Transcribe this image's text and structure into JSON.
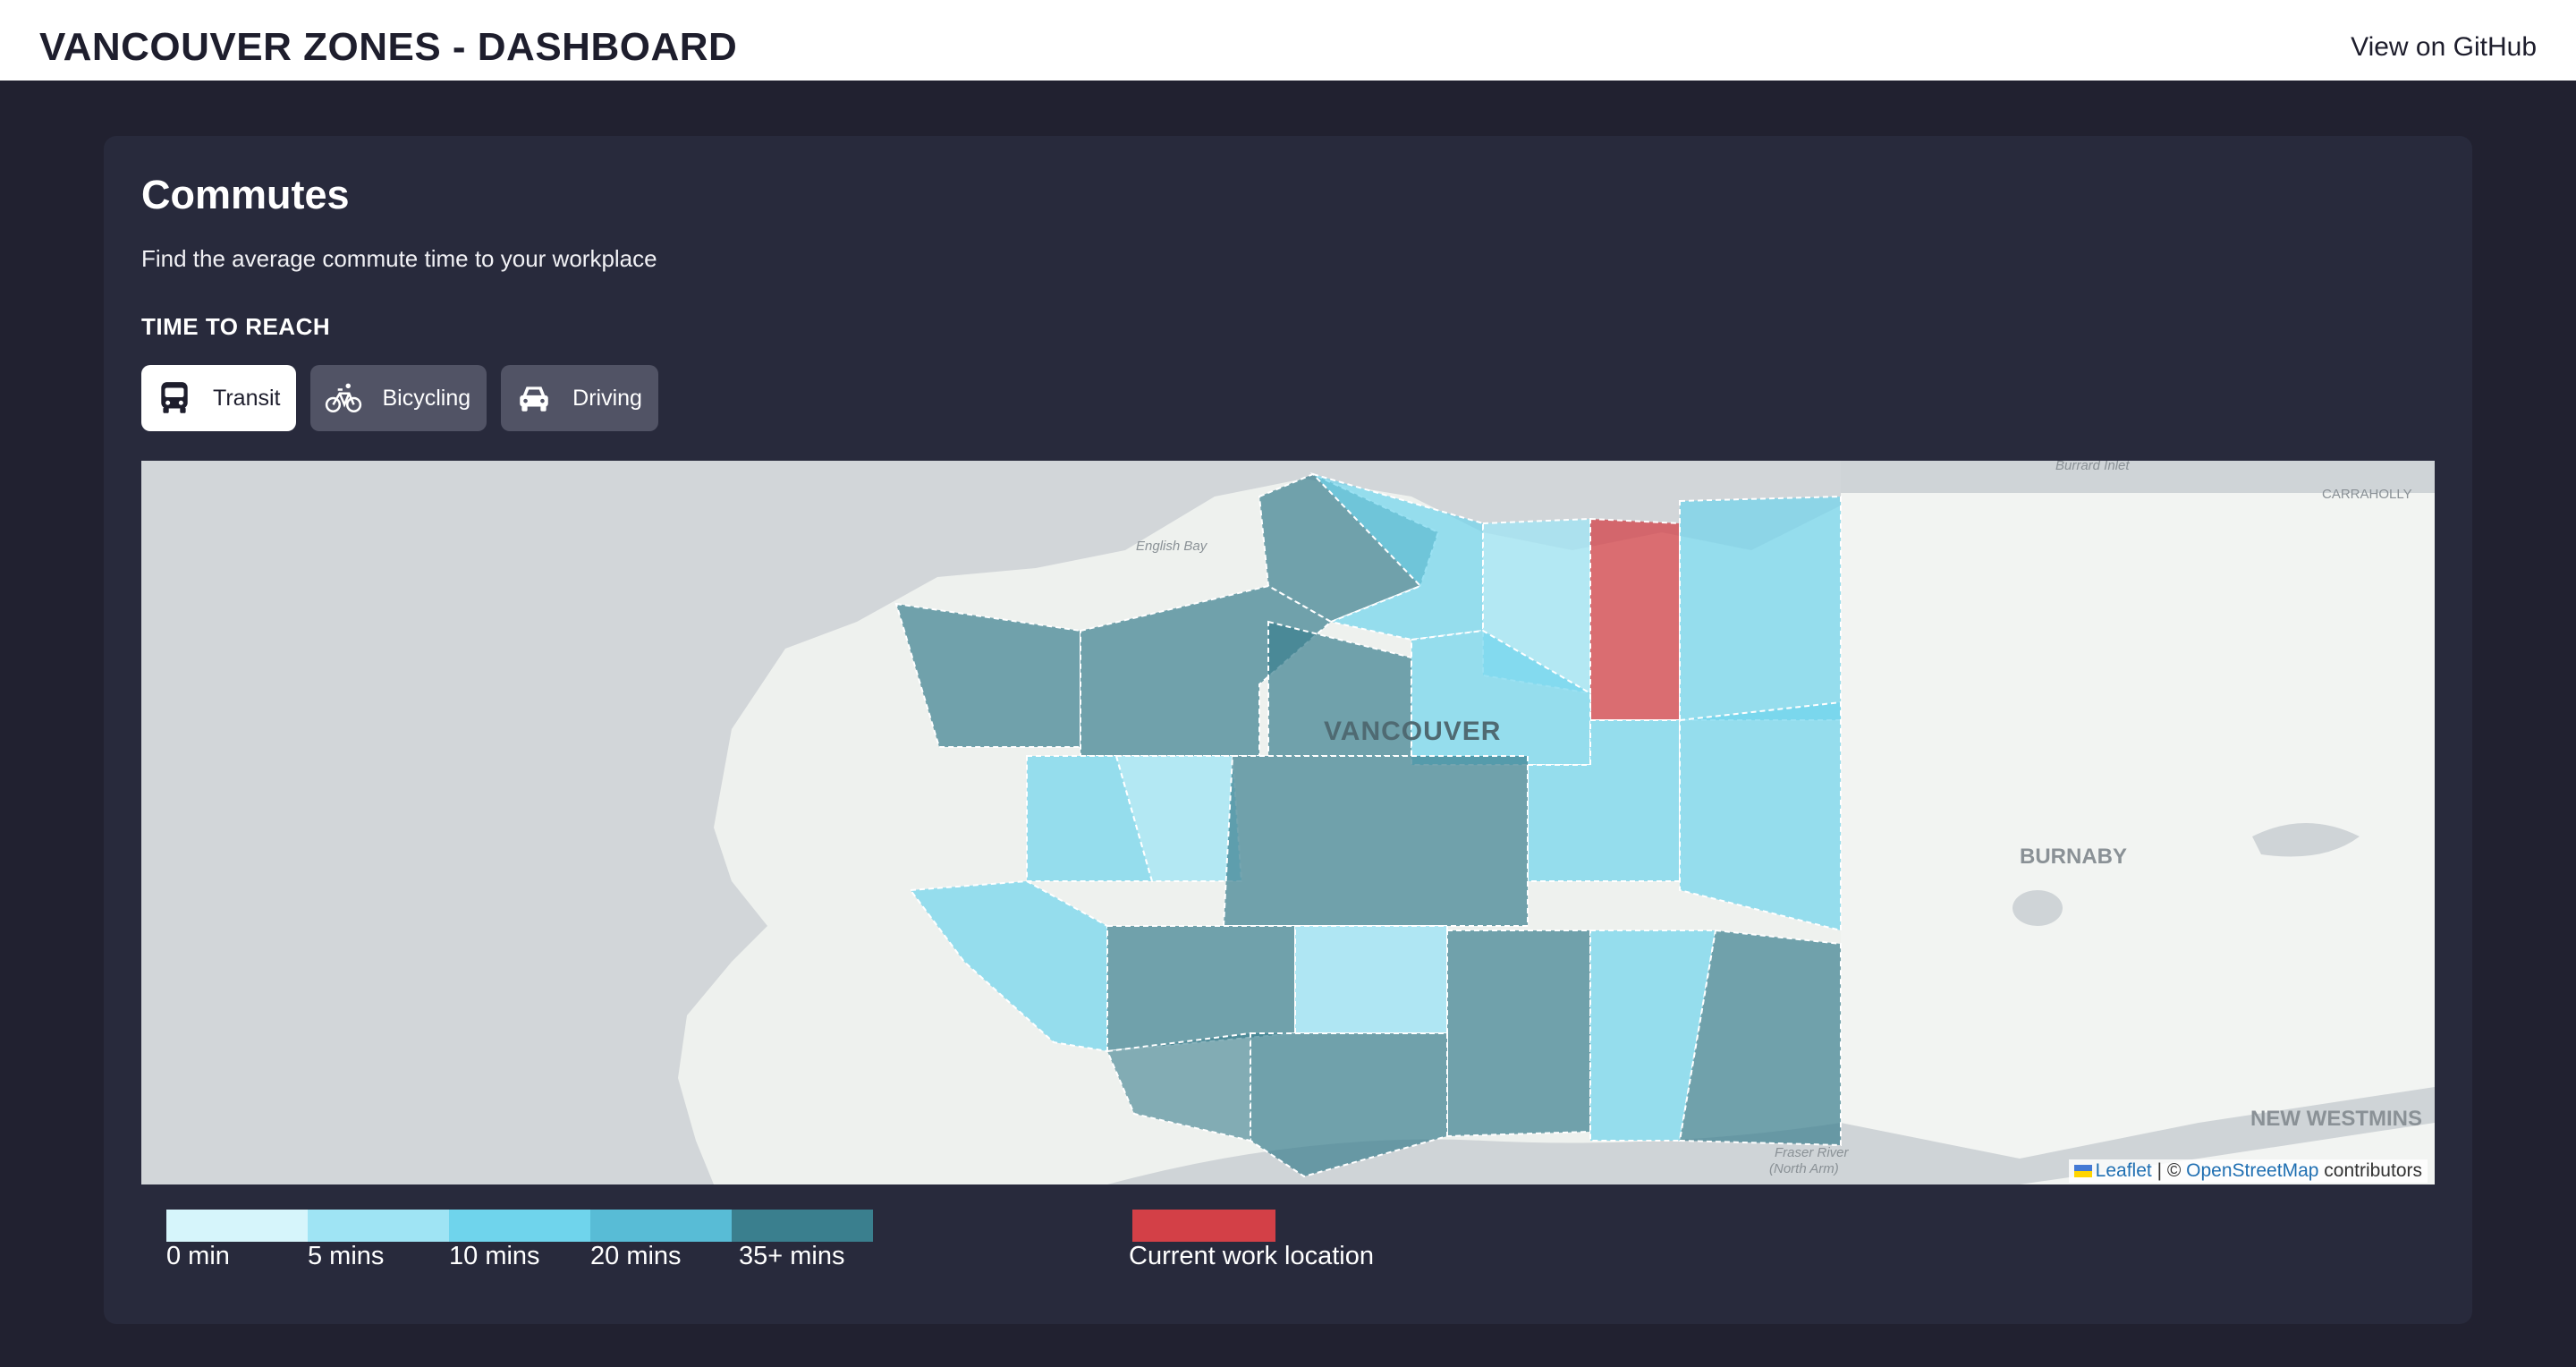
{
  "header": {
    "title": "VANCOUVER ZONES - DASHBOARD",
    "github_link": "View on GitHub"
  },
  "panel": {
    "title": "Commutes",
    "subtitle": "Find the average commute time to your workplace",
    "section_label": "TIME TO REACH",
    "modes": [
      {
        "label": "Transit",
        "icon": "bus-icon",
        "active": true
      },
      {
        "label": "Bicycling",
        "icon": "bicycle-icon",
        "active": false
      },
      {
        "label": "Driving",
        "icon": "car-icon",
        "active": false
      }
    ]
  },
  "map": {
    "place_labels": [
      "English Bay",
      "VANCOUVER",
      "Burrard Inlet",
      "CARRAHOLLY",
      "BURNABY",
      "NEW WESTMINS",
      "Fraser River",
      "(North Arm)"
    ],
    "attribution": {
      "leaflet": "Leaflet",
      "separator": "| ©",
      "osm": "OpenStreetMap",
      "contributors": "contributors"
    }
  },
  "legend": {
    "scale": [
      {
        "label": "0 min",
        "color": "#d6f5fb"
      },
      {
        "label": "5 mins",
        "color": "#9fe4f4"
      },
      {
        "label": "10 mins",
        "color": "#6fd4ec"
      },
      {
        "label": "20 mins",
        "color": "#58bcd6"
      },
      {
        "label": "35+ mins",
        "color": "#3a7f8e"
      }
    ],
    "work_location": {
      "label": "Current work location",
      "color": "#d34047"
    }
  }
}
